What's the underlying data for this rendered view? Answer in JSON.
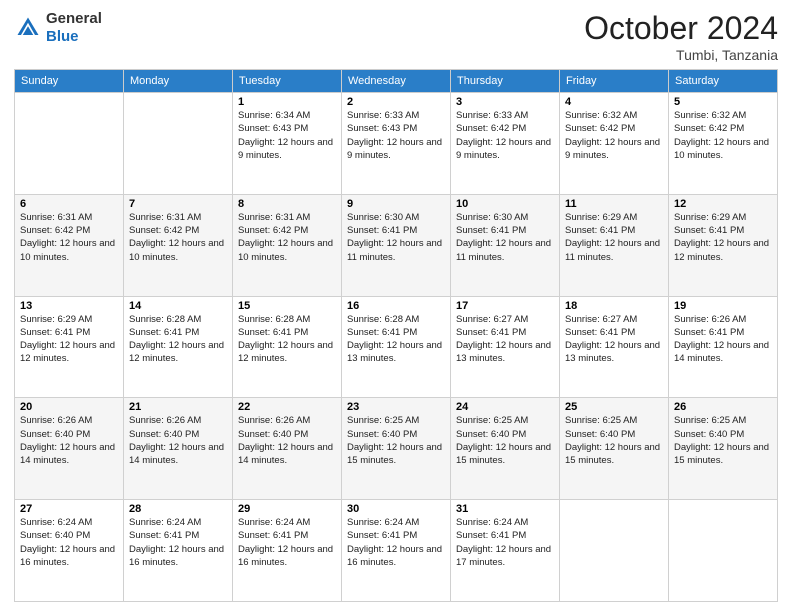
{
  "header": {
    "logo_line1": "General",
    "logo_line2": "Blue",
    "month": "October 2024",
    "location": "Tumbi, Tanzania"
  },
  "days_of_week": [
    "Sunday",
    "Monday",
    "Tuesday",
    "Wednesday",
    "Thursday",
    "Friday",
    "Saturday"
  ],
  "weeks": [
    [
      {
        "day": "",
        "sunrise": "",
        "sunset": "",
        "daylight": ""
      },
      {
        "day": "",
        "sunrise": "",
        "sunset": "",
        "daylight": ""
      },
      {
        "day": "1",
        "sunrise": "Sunrise: 6:34 AM",
        "sunset": "Sunset: 6:43 PM",
        "daylight": "Daylight: 12 hours and 9 minutes."
      },
      {
        "day": "2",
        "sunrise": "Sunrise: 6:33 AM",
        "sunset": "Sunset: 6:43 PM",
        "daylight": "Daylight: 12 hours and 9 minutes."
      },
      {
        "day": "3",
        "sunrise": "Sunrise: 6:33 AM",
        "sunset": "Sunset: 6:42 PM",
        "daylight": "Daylight: 12 hours and 9 minutes."
      },
      {
        "day": "4",
        "sunrise": "Sunrise: 6:32 AM",
        "sunset": "Sunset: 6:42 PM",
        "daylight": "Daylight: 12 hours and 9 minutes."
      },
      {
        "day": "5",
        "sunrise": "Sunrise: 6:32 AM",
        "sunset": "Sunset: 6:42 PM",
        "daylight": "Daylight: 12 hours and 10 minutes."
      }
    ],
    [
      {
        "day": "6",
        "sunrise": "Sunrise: 6:31 AM",
        "sunset": "Sunset: 6:42 PM",
        "daylight": "Daylight: 12 hours and 10 minutes."
      },
      {
        "day": "7",
        "sunrise": "Sunrise: 6:31 AM",
        "sunset": "Sunset: 6:42 PM",
        "daylight": "Daylight: 12 hours and 10 minutes."
      },
      {
        "day": "8",
        "sunrise": "Sunrise: 6:31 AM",
        "sunset": "Sunset: 6:42 PM",
        "daylight": "Daylight: 12 hours and 10 minutes."
      },
      {
        "day": "9",
        "sunrise": "Sunrise: 6:30 AM",
        "sunset": "Sunset: 6:41 PM",
        "daylight": "Daylight: 12 hours and 11 minutes."
      },
      {
        "day": "10",
        "sunrise": "Sunrise: 6:30 AM",
        "sunset": "Sunset: 6:41 PM",
        "daylight": "Daylight: 12 hours and 11 minutes."
      },
      {
        "day": "11",
        "sunrise": "Sunrise: 6:29 AM",
        "sunset": "Sunset: 6:41 PM",
        "daylight": "Daylight: 12 hours and 11 minutes."
      },
      {
        "day": "12",
        "sunrise": "Sunrise: 6:29 AM",
        "sunset": "Sunset: 6:41 PM",
        "daylight": "Daylight: 12 hours and 12 minutes."
      }
    ],
    [
      {
        "day": "13",
        "sunrise": "Sunrise: 6:29 AM",
        "sunset": "Sunset: 6:41 PM",
        "daylight": "Daylight: 12 hours and 12 minutes."
      },
      {
        "day": "14",
        "sunrise": "Sunrise: 6:28 AM",
        "sunset": "Sunset: 6:41 PM",
        "daylight": "Daylight: 12 hours and 12 minutes."
      },
      {
        "day": "15",
        "sunrise": "Sunrise: 6:28 AM",
        "sunset": "Sunset: 6:41 PM",
        "daylight": "Daylight: 12 hours and 12 minutes."
      },
      {
        "day": "16",
        "sunrise": "Sunrise: 6:28 AM",
        "sunset": "Sunset: 6:41 PM",
        "daylight": "Daylight: 12 hours and 13 minutes."
      },
      {
        "day": "17",
        "sunrise": "Sunrise: 6:27 AM",
        "sunset": "Sunset: 6:41 PM",
        "daylight": "Daylight: 12 hours and 13 minutes."
      },
      {
        "day": "18",
        "sunrise": "Sunrise: 6:27 AM",
        "sunset": "Sunset: 6:41 PM",
        "daylight": "Daylight: 12 hours and 13 minutes."
      },
      {
        "day": "19",
        "sunrise": "Sunrise: 6:26 AM",
        "sunset": "Sunset: 6:41 PM",
        "daylight": "Daylight: 12 hours and 14 minutes."
      }
    ],
    [
      {
        "day": "20",
        "sunrise": "Sunrise: 6:26 AM",
        "sunset": "Sunset: 6:40 PM",
        "daylight": "Daylight: 12 hours and 14 minutes."
      },
      {
        "day": "21",
        "sunrise": "Sunrise: 6:26 AM",
        "sunset": "Sunset: 6:40 PM",
        "daylight": "Daylight: 12 hours and 14 minutes."
      },
      {
        "day": "22",
        "sunrise": "Sunrise: 6:26 AM",
        "sunset": "Sunset: 6:40 PM",
        "daylight": "Daylight: 12 hours and 14 minutes."
      },
      {
        "day": "23",
        "sunrise": "Sunrise: 6:25 AM",
        "sunset": "Sunset: 6:40 PM",
        "daylight": "Daylight: 12 hours and 15 minutes."
      },
      {
        "day": "24",
        "sunrise": "Sunrise: 6:25 AM",
        "sunset": "Sunset: 6:40 PM",
        "daylight": "Daylight: 12 hours and 15 minutes."
      },
      {
        "day": "25",
        "sunrise": "Sunrise: 6:25 AM",
        "sunset": "Sunset: 6:40 PM",
        "daylight": "Daylight: 12 hours and 15 minutes."
      },
      {
        "day": "26",
        "sunrise": "Sunrise: 6:25 AM",
        "sunset": "Sunset: 6:40 PM",
        "daylight": "Daylight: 12 hours and 15 minutes."
      }
    ],
    [
      {
        "day": "27",
        "sunrise": "Sunrise: 6:24 AM",
        "sunset": "Sunset: 6:40 PM",
        "daylight": "Daylight: 12 hours and 16 minutes."
      },
      {
        "day": "28",
        "sunrise": "Sunrise: 6:24 AM",
        "sunset": "Sunset: 6:41 PM",
        "daylight": "Daylight: 12 hours and 16 minutes."
      },
      {
        "day": "29",
        "sunrise": "Sunrise: 6:24 AM",
        "sunset": "Sunset: 6:41 PM",
        "daylight": "Daylight: 12 hours and 16 minutes."
      },
      {
        "day": "30",
        "sunrise": "Sunrise: 6:24 AM",
        "sunset": "Sunset: 6:41 PM",
        "daylight": "Daylight: 12 hours and 16 minutes."
      },
      {
        "day": "31",
        "sunrise": "Sunrise: 6:24 AM",
        "sunset": "Sunset: 6:41 PM",
        "daylight": "Daylight: 12 hours and 17 minutes."
      },
      {
        "day": "",
        "sunrise": "",
        "sunset": "",
        "daylight": ""
      },
      {
        "day": "",
        "sunrise": "",
        "sunset": "",
        "daylight": ""
      }
    ]
  ]
}
